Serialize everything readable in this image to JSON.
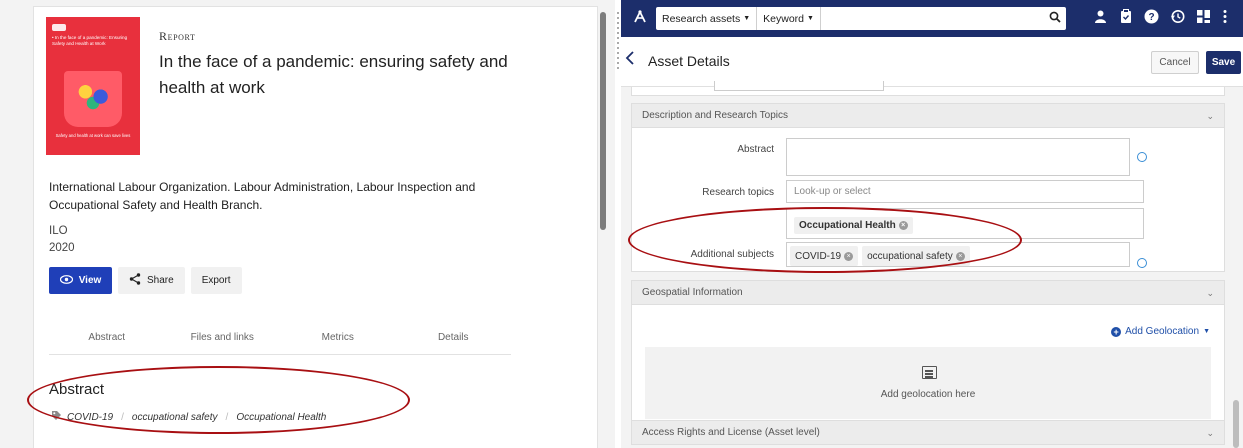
{
  "left_panel": {
    "cover": {
      "title_text": "• In the face of a pandemic: Ensuring Safety and Health at Work",
      "subtitle_text": "Safety and health at work can save lives"
    },
    "item_type": "Report",
    "title": "In the face of a pandemic: ensuring safety and health at work",
    "authors": "International Labour Organization. Labour Administration, Labour Inspection and Occupational Safety and Health Branch.",
    "publisher": "ILO",
    "year": "2020",
    "actions": {
      "view": "View",
      "share": "Share",
      "export": "Export"
    },
    "tabs": [
      "Abstract",
      "Files and links",
      "Metrics",
      "Details"
    ],
    "abstract_heading": "Abstract",
    "subject_tags": [
      "COVID-19",
      "occupational safety",
      "Occupational Health"
    ]
  },
  "right_panel": {
    "topbar": {
      "search_scope": "Research assets",
      "search_field": "Keyword",
      "search_value": ""
    },
    "header": {
      "title": "Asset Details",
      "cancel": "Cancel",
      "save": "Save"
    },
    "sections": {
      "description": "Description and Research Topics",
      "geospatial": "Geospatial Information",
      "access": "Access Rights and License (Asset level)"
    },
    "fields": {
      "abstract_label": "Abstract",
      "abstract_value": "",
      "research_topics_label": "Research topics",
      "research_topics_placeholder": "Look-up or select",
      "research_topic_chip": "Occupational Health",
      "additional_subjects_label": "Additional subjects",
      "additional_subject_chips": [
        "COVID-19",
        "occupational safety"
      ]
    },
    "geospatial": {
      "add_geolocation": "Add Geolocation",
      "hint": "Add geolocation here"
    }
  },
  "colors": {
    "topbar": "#1c2e6b",
    "primary_button": "#1f3fb8",
    "annotation_ellipse": "#a80f12",
    "cover_red": "#e8303d"
  },
  "icons": {
    "app_logo": "research-hub-icon",
    "search": "search-icon",
    "top_bar": [
      "user-icon",
      "clipboard-icon",
      "help-icon",
      "history-icon",
      "grid-icon",
      "more-vert-icon"
    ]
  }
}
